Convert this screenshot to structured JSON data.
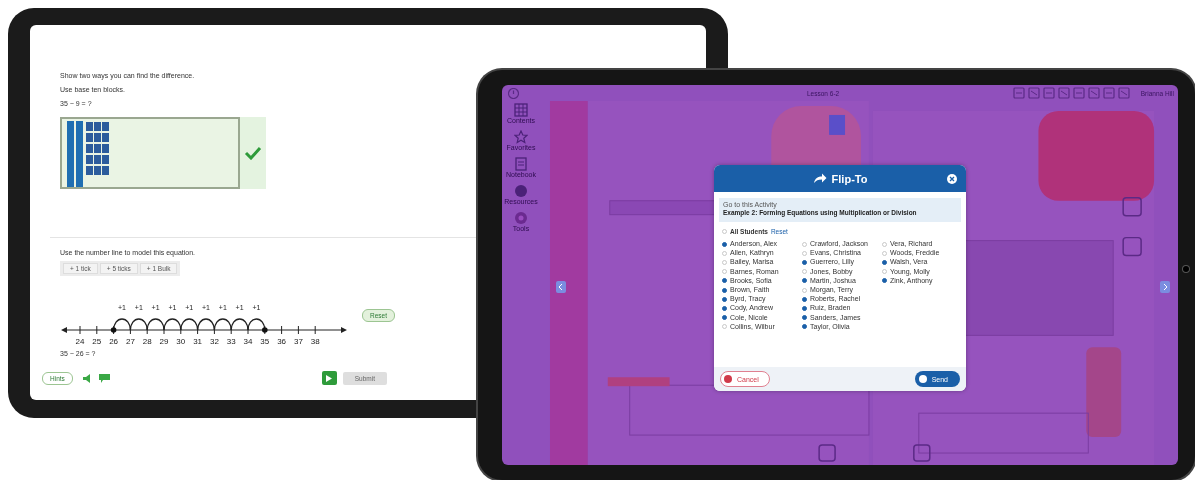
{
  "left_tablet": {
    "question_1": {
      "lines": [
        "Show two ways you can find the difference.",
        "Use base ten blocks.",
        "35 − 9 = ?"
      ],
      "answer_correct": true
    },
    "question_2": {
      "prompt": "Use the number line to model this equation.",
      "tools": [
        "+ 1 tick",
        "+ 5 ticks",
        "+ 1 Bulk"
      ],
      "number_line": {
        "ticks": [
          {
            "label": "24",
            "marked": false
          },
          {
            "label": "25",
            "marked": false
          },
          {
            "label": "26",
            "marked": true
          },
          {
            "label": "27",
            "marked": false
          },
          {
            "label": "28",
            "marked": false
          },
          {
            "label": "29",
            "marked": false
          },
          {
            "label": "30",
            "marked": false
          },
          {
            "label": "31",
            "marked": false
          },
          {
            "label": "32",
            "marked": false
          },
          {
            "label": "33",
            "marked": false
          },
          {
            "label": "34",
            "marked": false
          },
          {
            "label": "35",
            "marked": true
          },
          {
            "label": "36",
            "marked": false
          },
          {
            "label": "37",
            "marked": false
          },
          {
            "label": "38",
            "marked": false
          }
        ],
        "jumps": [
          "+1",
          "+1",
          "+1",
          "+1",
          "+1",
          "+1",
          "+1",
          "+1",
          "+1"
        ]
      },
      "reset": "Reset",
      "equation": "35 − 26 = ?"
    },
    "footer": {
      "hint_button": "Hints",
      "submit": "Submit"
    }
  },
  "right_tablet": {
    "toolbar_title": "Lesson 6-2",
    "user": "Brianna Hill",
    "sidebar": [
      {
        "kind": "contents",
        "label": "Contents"
      },
      {
        "kind": "star",
        "label": "Favorites"
      },
      {
        "kind": "notebook",
        "label": "Notebook"
      },
      {
        "kind": "resources",
        "label": "Resources"
      },
      {
        "kind": "tools",
        "label": "Tools"
      }
    ],
    "dialog": {
      "title": "Flip-To",
      "caption": "Go to this Activity",
      "lesson": "Example 2: Forming Equations using Multiplication or Division",
      "all_label": "All Students",
      "all_checked": false,
      "reset": "Reset",
      "students": [
        {
          "name": "Anderson, Alex",
          "checked": true
        },
        {
          "name": "Allen, Kathryn",
          "checked": false
        },
        {
          "name": "Bailey, Marisa",
          "checked": false
        },
        {
          "name": "Barnes, Roman",
          "checked": false
        },
        {
          "name": "Brooks, Sofia",
          "checked": true
        },
        {
          "name": "Brown, Faith",
          "checked": true
        },
        {
          "name": "Byrd, Tracy",
          "checked": true
        },
        {
          "name": "Cody, Andrew",
          "checked": true
        },
        {
          "name": "Cole, Nicole",
          "checked": true
        },
        {
          "name": "Collins, Wilbur",
          "checked": false
        },
        {
          "name": "Crawford, Jackson",
          "checked": false
        },
        {
          "name": "Evans, Christina",
          "checked": false
        },
        {
          "name": "Guerrero, Lilly",
          "checked": true
        },
        {
          "name": "Jones, Bobby",
          "checked": false
        },
        {
          "name": "Martin, Joshua",
          "checked": true
        },
        {
          "name": "Morgan, Terry",
          "checked": false
        },
        {
          "name": "Roberts, Rachel",
          "checked": true
        },
        {
          "name": "Ruiz, Braden",
          "checked": true
        },
        {
          "name": "Sanders, James",
          "checked": true
        },
        {
          "name": "Taylor, Olivia",
          "checked": true
        },
        {
          "name": "Vera, Richard",
          "checked": false
        },
        {
          "name": "Woods, Freddie",
          "checked": false
        },
        {
          "name": "Walsh, Vera",
          "checked": true
        },
        {
          "name": "Young, Molly",
          "checked": false
        },
        {
          "name": "Zink, Anthony",
          "checked": true
        }
      ],
      "cancel": "Cancel",
      "send": "Send"
    }
  }
}
